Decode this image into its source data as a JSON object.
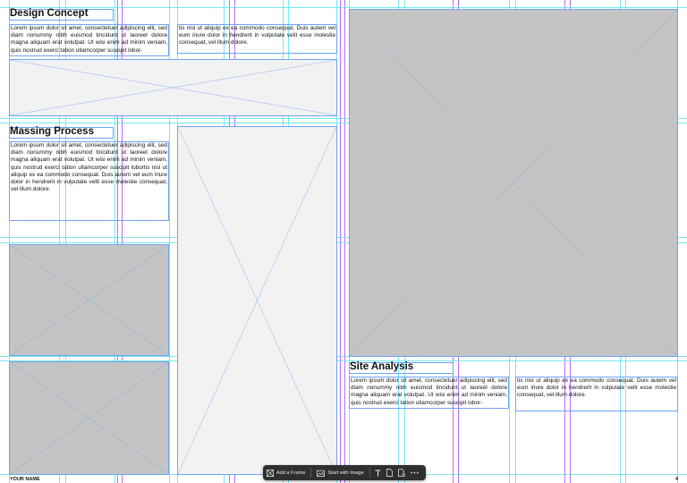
{
  "sections": {
    "design_concept": {
      "title": "Design Concept",
      "col1": "Lorem ipsum dolor sit amet, consectetuer adipiscing elit, sed diam nonummy nibh euismod tincidunt ut laoreet dolore magna aliquam erat volutpat. Ut wisi enim ad minim veniam, quis nostrud exerci tation ullamcorper suscipit lobor-",
      "col2": "tis nisl ut aliquip ex ea commodo consequat. Duis autem vel eum iriure dolor in hendrerit in vulputate velit esse molestie consequat, vel illum dolore."
    },
    "massing_process": {
      "title": "Massing Process",
      "col1": "Lorem ipsum dolor sit amet, consectetuer adipiscing elit, sed diam nonummy nibh euismod tincidunt ut laoreet dolore magna aliquam erat volutpat. Ut wisi enim ad minim veniam, quis nostrud exerci tation ullamcorper suscipit lobortis nisl ut aliquip ex ea commodo consequat. Duis autem vel eum iriure dolor in hendrerit in vulputate velit esse molestie consequat, vel illum dolore."
    },
    "site_analysis": {
      "title": "Site Analysis",
      "col1": "Lorem ipsum dolor sit amet, consectetuer adipiscing elit, sed diam nonummy nibh euismod tincidunt ut laoreet dolore magna aliquam erat volutpat. Ut wisi enim ad minim veniam, quis nostrud exerci tation ullamcorper suscipit lobor-",
      "col2": "tis nisl ut aliquip ex ea commodo consequat. Duis autem vel eum iriure dolor in hendrerit in vulputate velit esse molestie consequat, vel illum dolore."
    }
  },
  "footer": {
    "name": "YOUR NAME",
    "page_number": "4"
  },
  "toolbar": {
    "add_frame": "Add a Frame",
    "start_with_image": "Start with Image",
    "icons": [
      "frame-icon",
      "image-icon",
      "text-icon",
      "page-icon",
      "page-settings-icon",
      "more-icon"
    ]
  },
  "colors": {
    "guide_cyan": "#5fe3ea",
    "guide_magenta": "#b45cf0",
    "frame_border": "#6fa3f5",
    "placeholder_light": "#f2f2f2",
    "placeholder_dark": "#c4c4c4",
    "toolbar_bg": "#2f2f2f"
  }
}
